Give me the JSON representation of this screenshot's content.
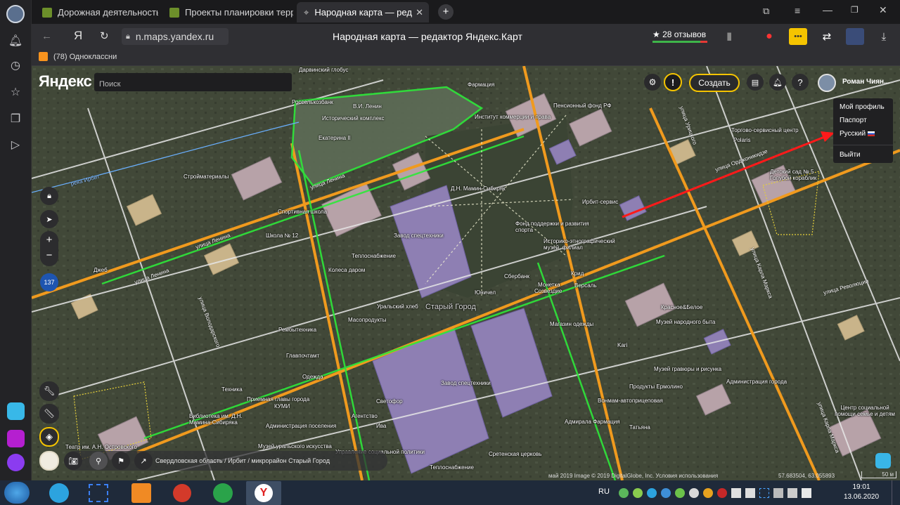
{
  "browser": {
    "tabs": [
      {
        "label": "Дорожная деятельность -"
      },
      {
        "label": "Проекты планировки терр"
      },
      {
        "label": "Народная карта — ред"
      }
    ],
    "address": "n.maps.yandex.ru",
    "page_title": "Народная карта — редактор Яндекс.Карт",
    "reviews": "★ 28 отзывов",
    "yandex_letter": "Я",
    "bookmark": "(78) Одноклассни"
  },
  "map": {
    "logo": "Яндекс",
    "search_placeholder": "Поиск",
    "create_button": "Создать",
    "user_name": "Роман Чиян...",
    "count_badge": "137",
    "user_menu": [
      "Мой профиль",
      "Паспорт",
      "Русский",
      "Выйти"
    ],
    "breadcrumb": "Свердловская область / Ирбит / микрорайон Старый Город",
    "copyright": "май 2019  Image © 2019 DigitalGlobe, Inc. Условия использования",
    "coords": "57.683504, 63.055893",
    "scale": "50 м",
    "labels": [
      "Дарвинский глобус",
      "Росселькозбанк",
      "В.И. Ленин",
      "Исторический комплекс",
      "Екатерина II",
      "Фармация",
      "Институт коммерции и права",
      "Пенсионный фонд РФ",
      "Торгово-сервисный центр",
      "Polaris",
      "Детский сад № 5 Голубой кораблик",
      "Стройматериалы",
      "Д.Н. Мамин-Сибиряк",
      "Спортивная школа",
      "Завод спецтехники",
      "Ирбит-сервис",
      "Фонд поддержки и развития спорта",
      "Историко-этнографический музей, филиал",
      "Школа № 12",
      "Теплоснабжение",
      "Колеса даром",
      "Уральский хлеб",
      "Старый Город",
      "Сбербанк",
      "Юничел",
      "Монетка",
      "Созвездие",
      "Крид",
      "Версаль",
      "Масопродукты",
      "Рембытехника",
      "Магазин одежды",
      "Красное&Белое",
      "Музей народного быта",
      "Главпочтамт",
      "Одежда",
      "Завод спецтехники",
      "Музей гравюры и рисунка",
      "Администрация города",
      "Техника",
      "Приемная главы города",
      "КУМИ",
      "Светофор",
      "Продукты Ермолино",
      "Библиотека им. Д.Н. Мамина-Сибиряка",
      "Администрация поселения",
      "Агентство",
      "Вонмам-автоприцеповая",
      "Адмирала Фармация",
      "Татьяна",
      "Центр социальной помощи семье и детям",
      "Театр им. А.Н. Островского",
      "Музей уральского искусства",
      "Управление социальной политики",
      "Сретенская церковь",
      "Теплоснабжение",
      "Джеб",
      "Ива",
      "Kari"
    ],
    "streets": [
      "улица Ленина",
      "улица Ленина",
      "улица Ленина",
      "улица Орджоникидзе",
      "улица Революции",
      "улица Карла Маркса",
      "улица Карла Маркса",
      "улица Урицкого",
      "улица Володарского",
      "река Ирбит"
    ]
  },
  "taskbar": {
    "lang": "RU",
    "time": "19:01",
    "date": "13.06.2020"
  }
}
